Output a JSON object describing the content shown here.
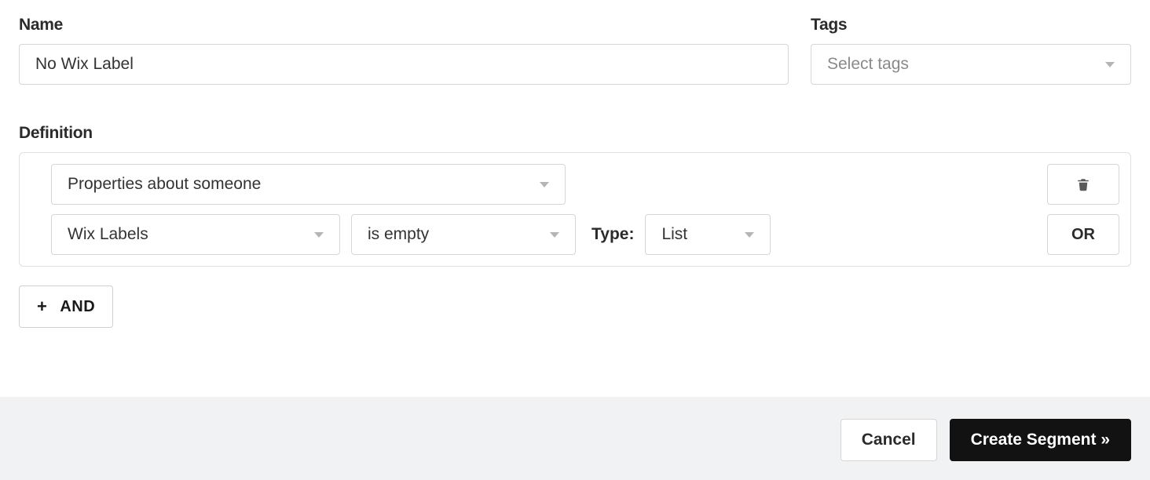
{
  "form": {
    "name_label": "Name",
    "name_value": "No Wix Label",
    "tags_label": "Tags",
    "tags_placeholder": "Select tags"
  },
  "definition": {
    "label": "Definition",
    "category_value": "Properties about someone",
    "property_value": "Wix Labels",
    "operator_value": "is empty",
    "type_label": "Type:",
    "type_value": "List",
    "or_label": "OR",
    "and_label": "AND"
  },
  "footer": {
    "cancel_label": "Cancel",
    "submit_label": "Create Segment »"
  },
  "icons": {
    "plus": "+",
    "trash": "trash-icon"
  }
}
